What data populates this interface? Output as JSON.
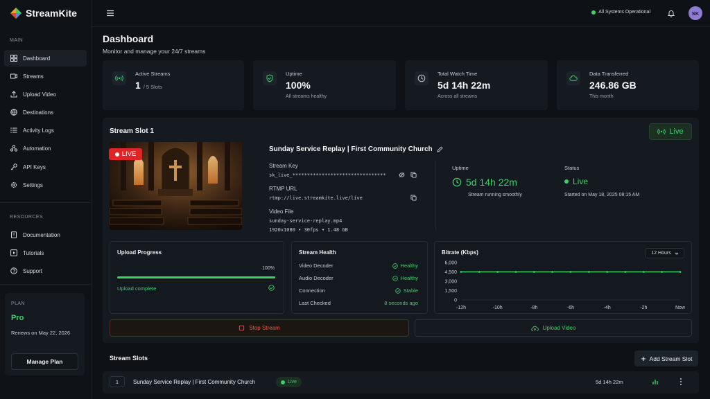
{
  "app": {
    "name": "StreamKite"
  },
  "sidebar": {
    "main_label": "MAIN",
    "items": [
      {
        "label": "Dashboard",
        "icon": "dashboard-icon",
        "active": true
      },
      {
        "label": "Streams",
        "icon": "streams-icon"
      },
      {
        "label": "Upload Video",
        "icon": "upload-icon"
      },
      {
        "label": "Destinations",
        "icon": "destinations-icon"
      },
      {
        "label": "Activity Logs",
        "icon": "list-icon"
      },
      {
        "label": "Automation",
        "icon": "automation-icon"
      },
      {
        "label": "API Keys",
        "icon": "key-icon"
      },
      {
        "label": "Settings",
        "icon": "gear-icon"
      }
    ],
    "resources_label": "RESOURCES",
    "resources": [
      {
        "label": "Documentation",
        "icon": "book-icon"
      },
      {
        "label": "Tutorials",
        "icon": "play-icon"
      },
      {
        "label": "Support",
        "icon": "help-icon"
      }
    ],
    "plan": {
      "label": "PLAN",
      "name": "Pro",
      "renew": "Renews on May 22, 2026",
      "button": "Manage Plan"
    }
  },
  "topbar": {
    "status": "All Systems Operational",
    "avatar": "SK"
  },
  "header": {
    "title": "Dashboard",
    "subtitle": "Monitor and manage your 24/7 streams"
  },
  "stats": [
    {
      "label": "Active Streams",
      "value": "1",
      "suffix": "/ 5 Slots",
      "sub": "",
      "icon": "broadcast-icon"
    },
    {
      "label": "Uptime",
      "value": "100%",
      "suffix": "",
      "sub": "All streams healthy",
      "icon": "shield-check-icon"
    },
    {
      "label": "Total Watch Time",
      "value": "5d 14h 22m",
      "suffix": "",
      "sub": "Across all streams",
      "icon": "clock-icon"
    },
    {
      "label": "Data Transferred",
      "value": "246.86 GB",
      "suffix": "",
      "sub": "This month",
      "icon": "cloud-icon"
    }
  ],
  "slot": {
    "title": "Stream Slot 1",
    "status_badge": "Live",
    "thumb_tag": "LIVE",
    "stream_name": "Sunday Service Replay | First Community Church",
    "stream_key_label": "Stream Key",
    "stream_key": "sk_live_********************************",
    "rtmp_label": "RTMP URL",
    "rtmp_url": "rtmp://live.streamkite.live/live",
    "video_label": "Video File",
    "video_file": "sunday-service-replay.mp4",
    "video_meta": "1920x1080 • 30fps • 1.48 GB",
    "uptime_label": "Uptime",
    "uptime_value": "5d 14h 22m",
    "uptime_sub": "Stream running smoothly",
    "status_label": "Status",
    "status_value": "Live",
    "status_sub": "Started on May 18, 2025 08:15 AM"
  },
  "upload": {
    "title": "Upload Progress",
    "percent": 100,
    "percent_label": "100%",
    "status": "Upload complete"
  },
  "health": {
    "title": "Stream Health",
    "rows": [
      {
        "key": "Video Decoder",
        "value": "Healthy",
        "check": true
      },
      {
        "key": "Audio Decoder",
        "value": "Healthy",
        "check": true
      },
      {
        "key": "Connection",
        "value": "Stable",
        "check": true
      },
      {
        "key": "Last Checked",
        "value": "8 seconds ago",
        "check": false
      }
    ]
  },
  "chart_data": {
    "type": "line",
    "title": "Bitrate (Kbps)",
    "range_option": "12 Hours",
    "x": [
      "-12h",
      "-11h",
      "-10h",
      "-9h",
      "-8h",
      "-7h",
      "-6h",
      "-5h",
      "-4h",
      "-3h",
      "-2h",
      "-1h",
      "Now"
    ],
    "x_tick_labels": [
      "-12h",
      "-10h",
      "-8h",
      "-6h",
      "-4h",
      "-2h",
      "Now"
    ],
    "y_ticks": [
      0,
      1500,
      3000,
      4500,
      6000
    ],
    "y_tick_labels": [
      "0",
      "1,500",
      "3,000",
      "4,500",
      "6,000"
    ],
    "ylim": [
      0,
      6000
    ],
    "series": [
      {
        "values": [
          4500,
          4500,
          4500,
          4500,
          4500,
          4500,
          4500,
          4500,
          4500,
          4500,
          4500,
          4500,
          4500
        ],
        "color": "#3ecf6a"
      }
    ]
  },
  "actions": {
    "stop": "Stop Stream",
    "upload": "Upload Video"
  },
  "slots": {
    "title": "Stream Slots",
    "add_button": "Add Stream Slot",
    "rows": [
      {
        "num": "1",
        "name": "Sunday Service Replay | First Community Church",
        "status": "Live",
        "uptime": "5d 14h 22m"
      }
    ]
  },
  "colors": {
    "accent": "#3ecf6a",
    "danger": "#e35b4b",
    "background": "#0e1116",
    "card": "#151a20"
  }
}
